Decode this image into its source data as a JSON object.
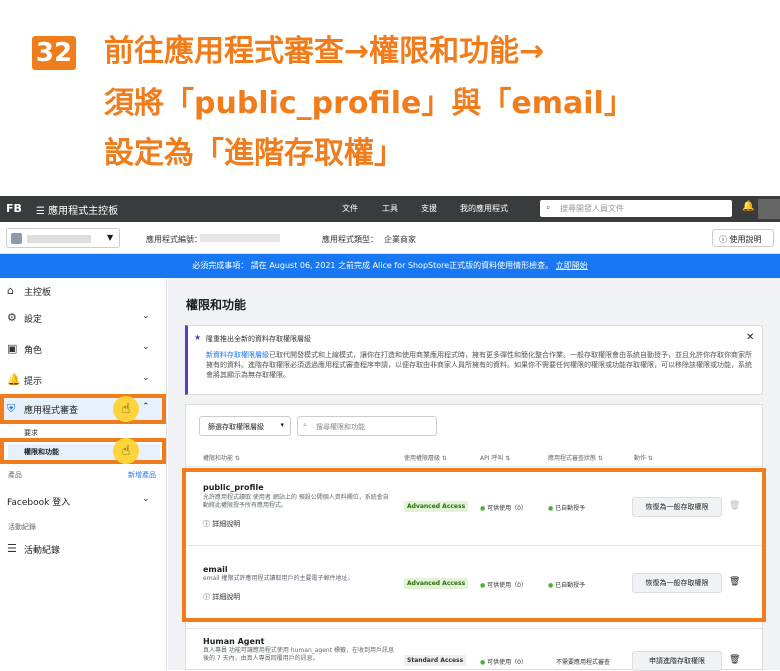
{
  "headline": {
    "step_number": "32",
    "line1": "前往應用程式審查→權限和功能→",
    "line2": "須將「public_profile」與「email」",
    "line3": "設定為「進階存取權」",
    "accent_color": "#f07c1c"
  },
  "topbar": {
    "logo": "FB",
    "menu_icon": "hamburger-icon",
    "app_dashboard": "應用程式主控板",
    "nav": [
      "文件",
      "工具",
      "支援",
      "我的應用程式"
    ],
    "search_placeholder": "搜尋開發人員文件"
  },
  "appbar": {
    "app_id_label": "應用程式編號：",
    "app_type_label": "應用程式類型：",
    "app_type_value": "企業商家",
    "help": "使用說明"
  },
  "banner": {
    "text": "必須完成事項： 請在 August 06, 2021 之前完成 Alice for ShopStore正式版的資料使用情形檢查。",
    "link": "立即開始",
    "color": "#1877f2"
  },
  "sidebar": {
    "items": [
      {
        "label": "主控板",
        "icon": "home-icon"
      },
      {
        "label": "設定",
        "icon": "gear-icon"
      },
      {
        "label": "角色",
        "icon": "roles-icon"
      },
      {
        "label": "提示",
        "icon": "bell-icon"
      },
      {
        "label": "應用程式審查",
        "icon": "shield-check-icon"
      }
    ],
    "sub_requests": "要求",
    "sub_permissions": "權限和功能",
    "products": "產品",
    "add_product": "新增產品",
    "facebook_login": "Facebook 登入",
    "activity_section": "活動紀錄",
    "activity_log": "活動紀錄"
  },
  "main": {
    "title": "權限和功能",
    "notice": {
      "title": "隆重推出全新的資料存取權限層級",
      "body_link": "新資料存取權限層級",
      "body": "已取代開發模式和上線模式，讓你在打造和使用商業應用程式時，擁有更多彈性和簡化整合作業。一般存取權限會由系統自動授予，並且允許你存取你商家所擁有的資料。進階存取權限必須透過應用程式審查程序申請，以便存取由非商家人員所擁有的資料。如果你不需要任何權限的權限或功能存取權限，可以移除該權限或功能，系統會將其顯示為無存取權限。"
    },
    "filter": "篩選存取權限層級",
    "search_placeholder": "搜尋權限和功能",
    "headers": [
      "權限和功能 ⇅",
      "使用權限層級 ⇅",
      "API 呼叫 ⇅",
      "應用程式審查狀態 ⇅",
      "動作 ⇅"
    ],
    "rows": [
      {
        "name": "public_profile",
        "desc": "允許應用程式讀取 使用者 網站上的 預設公開個人資料欄位，系統會自動將此權限授予所有應用程式。",
        "detail": "詳細說明",
        "level": "Advanced Access",
        "api": "可供使用（0）",
        "review": "已自動授予",
        "action": "恢復為一般存取權限"
      },
      {
        "name": "email",
        "desc": "email 權限式許應用程式讀取用戶的主要電子郵件地址。",
        "detail": "詳細說明",
        "level": "Advanced Access",
        "api": "可供使用（0）",
        "review": "已自動授予",
        "action": "恢復為一般存取權限"
      },
      {
        "name": "Human Agent",
        "desc": "真人專員 功能可讓應用程式使用 human_agent 標籤，在收到用戶訊息後的 7 天內，由真人專員回覆用戶的訊息。",
        "level": "Standard Access",
        "api": "可供使用（0）",
        "review": "不需要應用程式審查",
        "action": "申請進階存取權限"
      }
    ]
  }
}
